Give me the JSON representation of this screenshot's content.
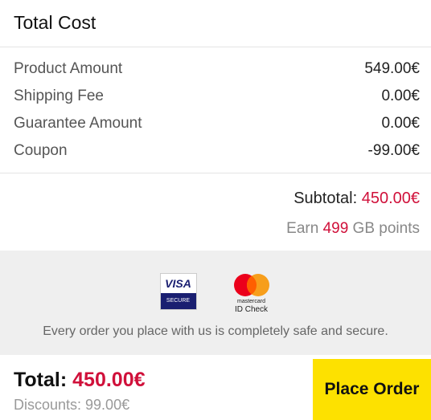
{
  "title": "Total Cost",
  "lines": [
    {
      "label": "Product Amount",
      "value": "549.00€"
    },
    {
      "label": "Shipping Fee",
      "value": "0.00€"
    },
    {
      "label": "Guarantee Amount",
      "value": "0.00€"
    },
    {
      "label": "Coupon",
      "value": "-99.00€"
    }
  ],
  "subtotal": {
    "label": "Subtotal: ",
    "value": "450.00€"
  },
  "earn": {
    "prefix": "Earn ",
    "points": "499",
    "suffix": " GB points"
  },
  "secure": {
    "visa_logo": "VISA",
    "visa_sub": "SECURE",
    "mastercard_name": "mastercard",
    "mastercard_sub": "ID Check",
    "note": "Every order you place with us is completely safe and secure."
  },
  "footer": {
    "total_label": "Total: ",
    "total_value": "450.00€",
    "discounts": "Discounts: 99.00€",
    "place_order": "Place Order"
  },
  "colors": {
    "accent": "#d0103a",
    "button": "#fde100",
    "panel": "#efefef"
  }
}
